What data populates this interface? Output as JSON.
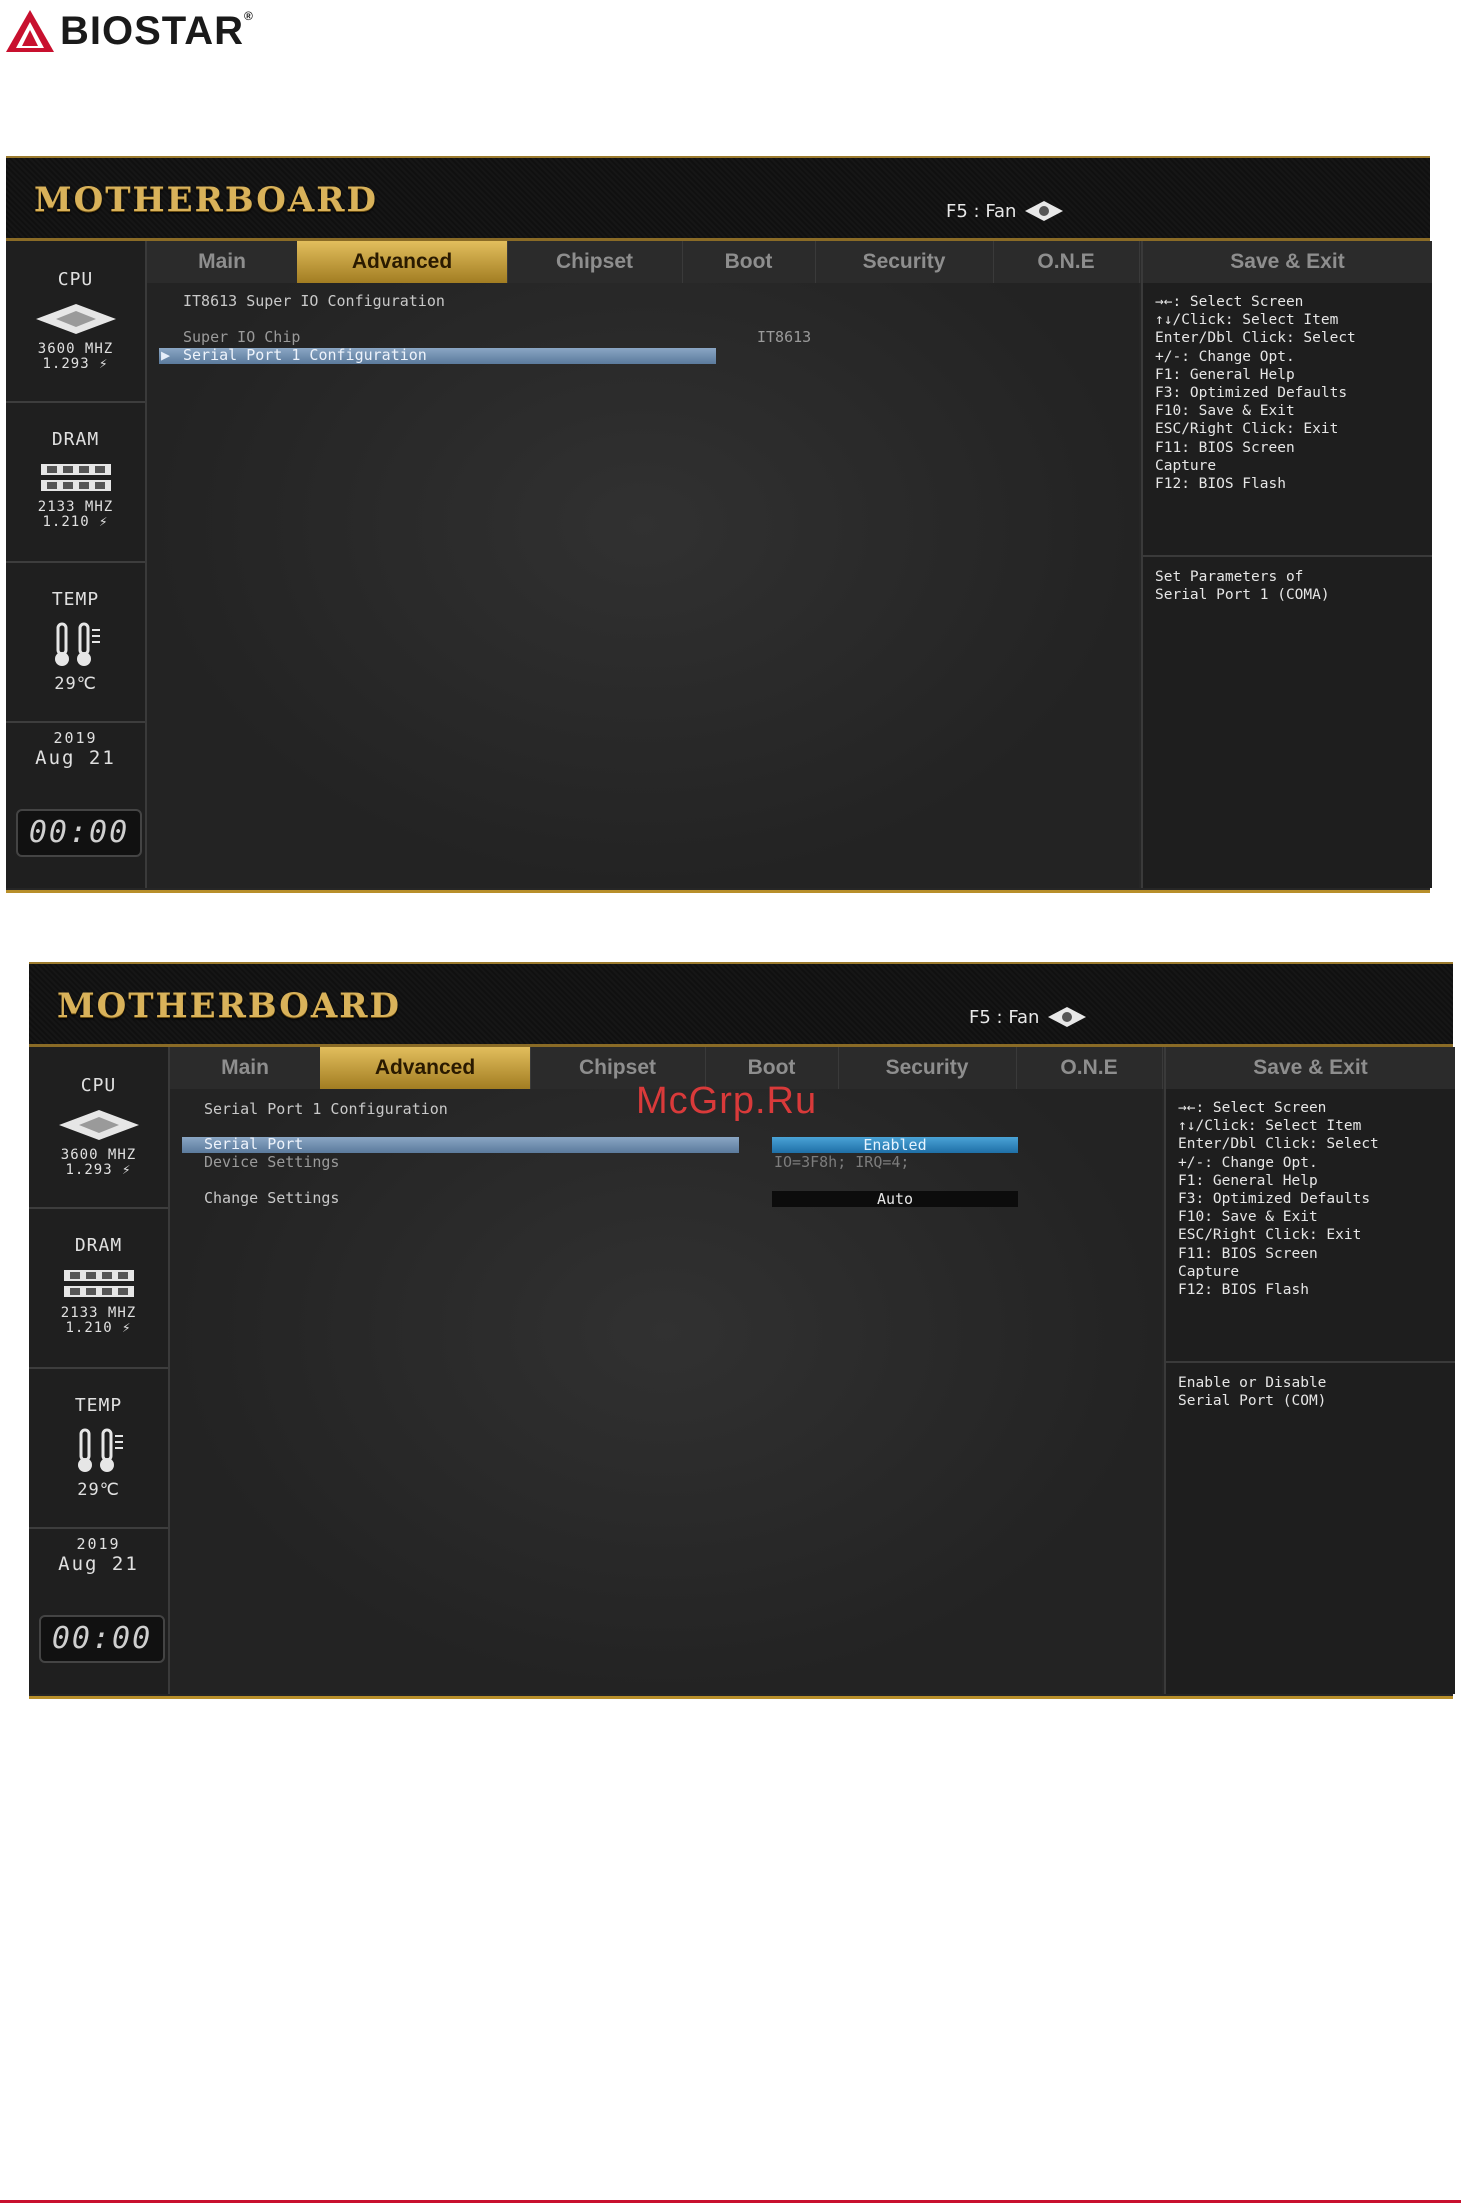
{
  "brand": {
    "name": "BIOSTAR",
    "reg": "®",
    "colors": {
      "red": "#c8102e",
      "gold": "#d9b25a"
    }
  },
  "watermark": "McGrp.Ru",
  "common": {
    "header_title": "MOTHERBOARD",
    "fan_hint": "F5 : Fan",
    "tabs": [
      "Main",
      "Advanced",
      "Chipset",
      "Boot",
      "Security",
      "O.N.E"
    ],
    "active_tab": "Advanced",
    "save_exit_tab": "Save & Exit",
    "sidebar": {
      "cpu_label": "CPU",
      "cpu_freq": "3600 MHZ",
      "cpu_volt": "1.293 ⚡",
      "dram_label": "DRAM",
      "dram_freq": "2133 MHZ",
      "dram_volt": "1.210 ⚡",
      "temp_label": "TEMP",
      "temp_value": "29℃",
      "year": "2019",
      "date": "Aug 21",
      "clock": "00:00"
    },
    "help_lines": [
      "→←: Select Screen",
      "↑↓/Click: Select Item",
      "Enter/Dbl Click: Select",
      "+/-: Change Opt.",
      "F1: General Help",
      "F3: Optimized Defaults",
      "F10: Save & Exit",
      "ESC/Right Click: Exit",
      "F11: BIOS Screen",
      "Capture",
      "F12: BIOS Flash"
    ]
  },
  "screen1": {
    "section_title": "IT8613 Super IO Configuration",
    "items": [
      {
        "label": "Super IO Chip",
        "value": "IT8613"
      },
      {
        "label": "Serial Port 1 Configuration",
        "value": ""
      }
    ],
    "description_lines": [
      "Set Parameters of",
      "Serial Port 1 (COMA)"
    ]
  },
  "screen2": {
    "section_title": "Serial Port 1 Configuration",
    "items": [
      {
        "label": "Serial Port",
        "value": "Enabled"
      },
      {
        "label": "Device Settings",
        "value": "IO=3F8h; IRQ=4;"
      },
      {
        "label": "Change Settings",
        "value": "Auto"
      }
    ],
    "description_lines": [
      "Enable or Disable",
      "Serial Port (COM)"
    ]
  }
}
